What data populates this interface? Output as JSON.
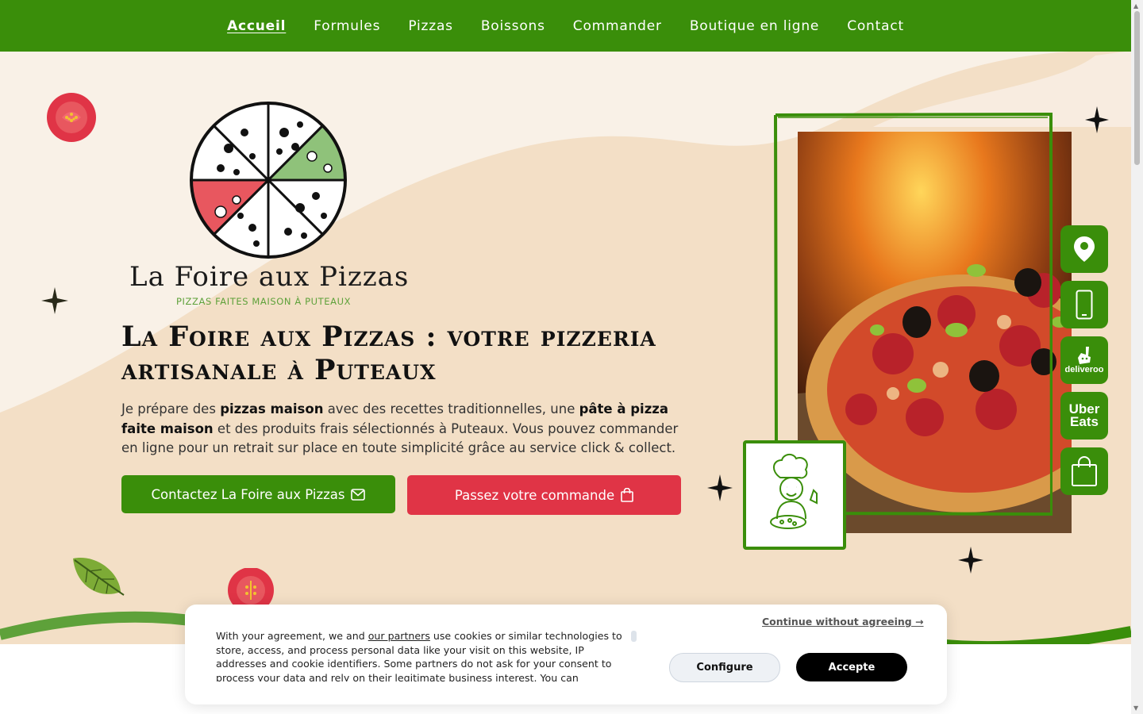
{
  "nav": {
    "items": [
      {
        "label": "Accueil",
        "active": true
      },
      {
        "label": "Formules"
      },
      {
        "label": "Pizzas"
      },
      {
        "label": "Boissons"
      },
      {
        "label": "Commander"
      },
      {
        "label": "Boutique en ligne"
      },
      {
        "label": "Contact"
      }
    ]
  },
  "logo": {
    "title": "La Foire aux Pizzas",
    "subtitle": "PIZZAS FAITES MAISON À PUTEAUX"
  },
  "hero": {
    "headline": "La Foire aux Pizzas : votre pizzeria artisanale à Puteaux",
    "intro": {
      "t1": "Je prépare des ",
      "b1": "pizzas maison",
      "t2": " avec des recettes traditionnelles, une ",
      "b2": "pâte à pizza faite maison",
      "t3": " et des produits frais sélectionnés à Puteaux. Vous pouvez commander en ligne pour un retrait sur place en toute simplicité grâce au service click & collect."
    },
    "contact_button": "Contactez La Foire aux Pizzas",
    "order_button": "Passez votre commande"
  },
  "side_icons": [
    {
      "icon": "location-pin-icon"
    },
    {
      "icon": "phone-icon"
    },
    {
      "icon": "deliveroo-icon",
      "label": "deliveroo"
    },
    {
      "icon": "ubereats-icon",
      "line1": "Uber",
      "line2": "Eats"
    },
    {
      "icon": "shopping-bag-icon"
    }
  ],
  "cookie": {
    "text_before": "With your agreement, we and ",
    "partners_link": "our partners",
    "text_after": " use cookies or similar technologies to store, access, and process personal data like your visit on this website, IP addresses and cookie identifiers. Some partners do not ask for your consent to process your data and rely on their legitimate business interest. You can",
    "continue": "Continue without agreeing →",
    "configure": "Configure",
    "accept": "Accepte"
  },
  "colors": {
    "brand_green": "#3a8e0a",
    "brand_red": "#e03446",
    "cream": "#f8efe4",
    "peach": "#f3dfc6"
  }
}
